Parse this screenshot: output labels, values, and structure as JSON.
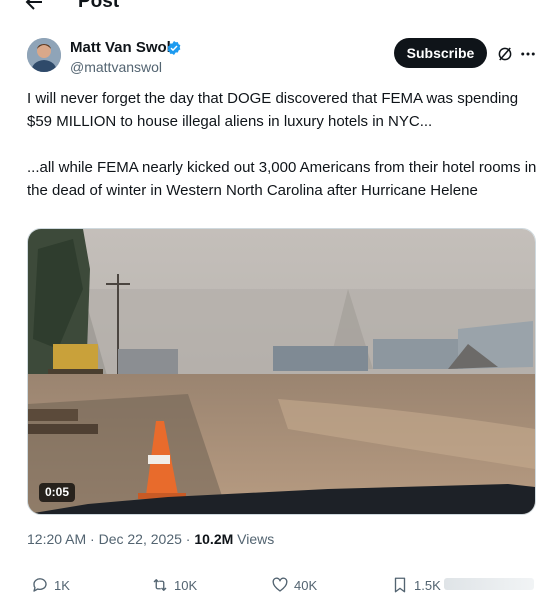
{
  "header": {
    "title": "Post",
    "back_icon": "arrow-left-icon"
  },
  "author": {
    "name": "Matt Van Swol",
    "handle": "@mattvanswol",
    "verified_icon": "verified-badge-icon",
    "subscribe_label": "Subscribe",
    "grok_icon": "grok-icon",
    "more_icon": "more-horizontal-icon"
  },
  "tweet": {
    "paragraph1": "I will never forget the day that DOGE discovered that FEMA was spending $59 MILLION to house illegal aliens in luxury hotels in NYC...",
    "paragraph2": "...all while FEMA nearly kicked out 3,000 Americans from their hotel rooms in the dead of winter in Western North Carolina after Hurricane Helene"
  },
  "media": {
    "type": "video",
    "duration": "0:05"
  },
  "meta": {
    "time": "12:20 AM",
    "separator": " · ",
    "date": "Dec 22, 2025",
    "views_count": "10.2M",
    "views_label": " Views"
  },
  "actions": {
    "replies": "1K",
    "reposts": "10K",
    "likes": "40K",
    "bookmarks": "1.5K"
  },
  "colors": {
    "text": "#0f1419",
    "muted": "#536471",
    "verified": "#1d9bf0",
    "button": "#0f1419"
  }
}
